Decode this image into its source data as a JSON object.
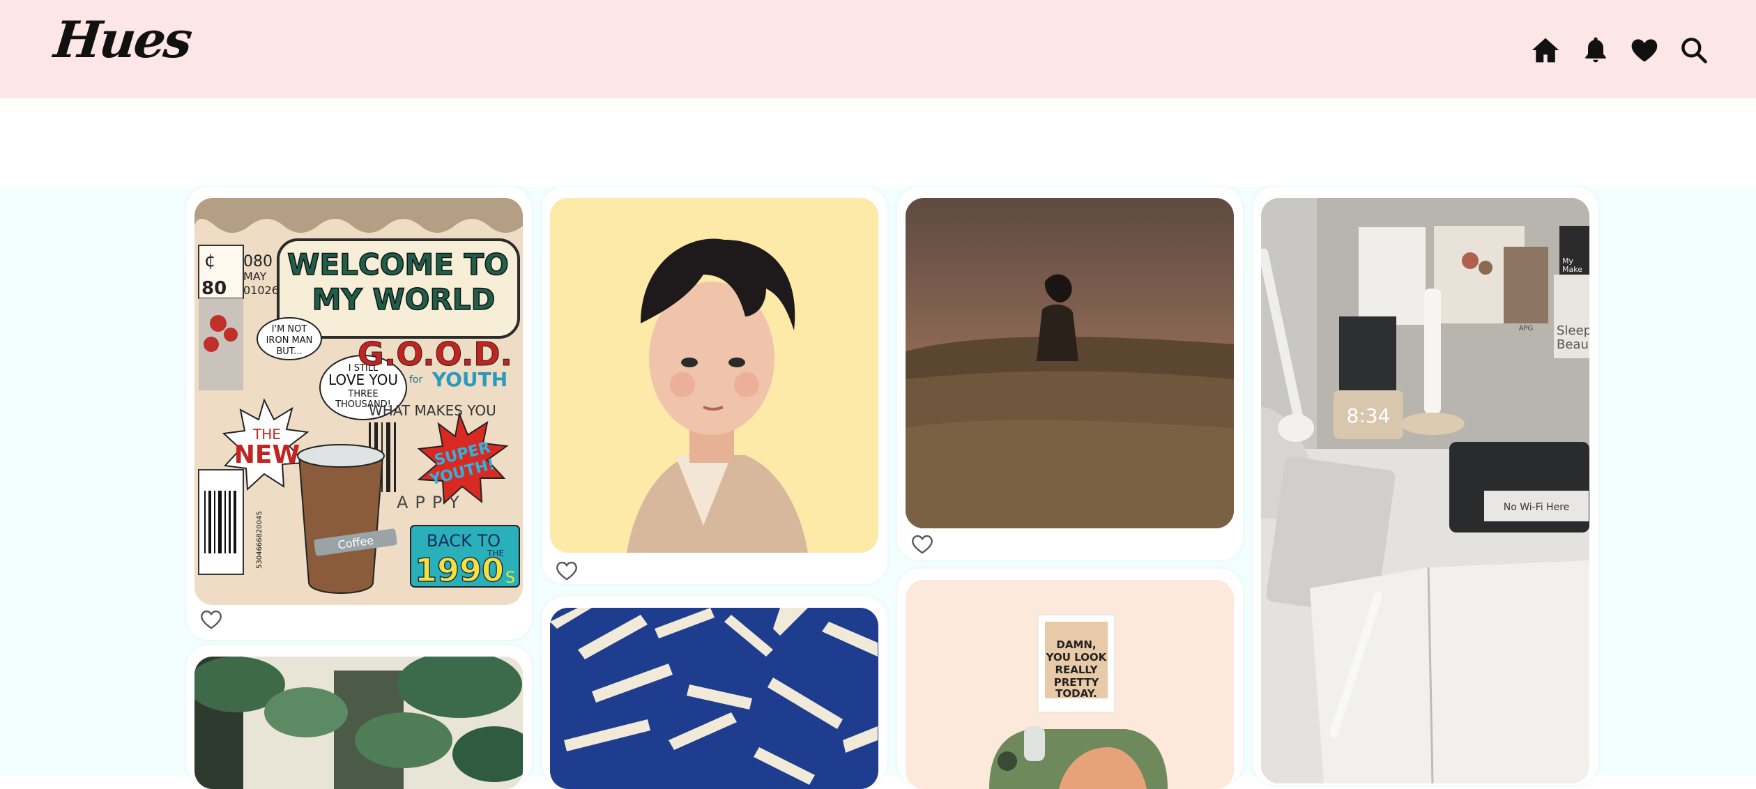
{
  "app": {
    "logo": "Hues"
  },
  "nav": {
    "icons": [
      "home-icon",
      "bell-icon",
      "heart-icon",
      "search-icon"
    ]
  },
  "colors": {
    "header_bg": "#fde6e6",
    "board_bg": "#f3fffe",
    "card_bg": "#ffffff"
  },
  "pins": {
    "p1": {
      "lines": [
        "WELCOME TO",
        "MY WORLD",
        "G.O.O.D.",
        "YOUTH",
        "I'M NOT",
        "IRON MAN",
        "BUT...",
        "I STILL",
        "LOVE YOU",
        "THREE",
        "THOUSAND!",
        "THE",
        "NEW",
        "SUPER",
        "YOUTH!",
        "BACK TO",
        "THE",
        "1990",
        "S",
        "WHAT MAKES YOU",
        "APPY",
        "080",
        "MAY",
        "01026",
        "80",
        "¢",
        "for",
        "Coffee",
        "5304666820045"
      ]
    },
    "p3": {
      "lines": []
    },
    "p4": {
      "lines": [
        "DAMN,",
        "YOU LOOK",
        "REALLY",
        "PRETTY",
        "TODAY."
      ]
    },
    "p5": {
      "lines": [
        "8:34",
        "Sleep",
        "Beau",
        "My",
        "Make",
        "No Wi-Fi Here",
        "APG"
      ]
    }
  }
}
